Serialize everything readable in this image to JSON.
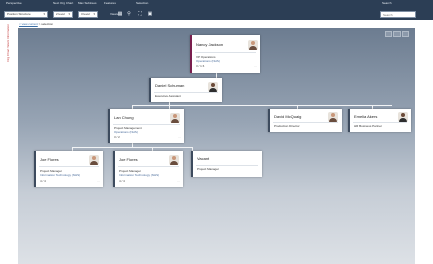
{
  "toolbar": {
    "perspective_label": "Perspective",
    "perspective_value": "Position Structure",
    "next_org_chart_label": "Next Org Chart",
    "next_org_chart_value": "2 level",
    "max_subtrees_label": "Max Subtrees",
    "max_subtrees_value": "3 level",
    "features_label": "Features",
    "features_item": "Views",
    "selection_label": "Selection",
    "search_label": "Search",
    "search_placeholder": "Search"
  },
  "side_tab": "Org Chart  Talent Information",
  "breadcrumb": {
    "back": "< view current",
    "current": "> selection"
  },
  "org": {
    "nancy": {
      "name": "Nancy Jackson",
      "title": "VP Operations",
      "dept": "Operations (NHS)",
      "count": "3 / 1 6"
    },
    "daniel": {
      "name": "Daniel Schuman",
      "title": "Executive Assistant"
    },
    "lan": {
      "name": "Lan Chung",
      "title": "Project Management",
      "dept": "Operations (NHS)",
      "count": "3 / 2"
    },
    "david": {
      "name": "David McQuaig",
      "title": "Production Director"
    },
    "emelia": {
      "name": "Emelia Akers",
      "title": "HR Business Partner"
    },
    "joe1": {
      "name": "Joe Flores",
      "title": "Project Manager",
      "dept": "Information Technology (NHS)",
      "count": "4 / 4"
    },
    "joe2": {
      "name": "Joe Flores",
      "title": "Project Manager",
      "dept": "Information Technology (NHS)",
      "count": "4 / 4"
    },
    "vacant": {
      "name": "Vacant",
      "title": "Project Manager"
    }
  }
}
